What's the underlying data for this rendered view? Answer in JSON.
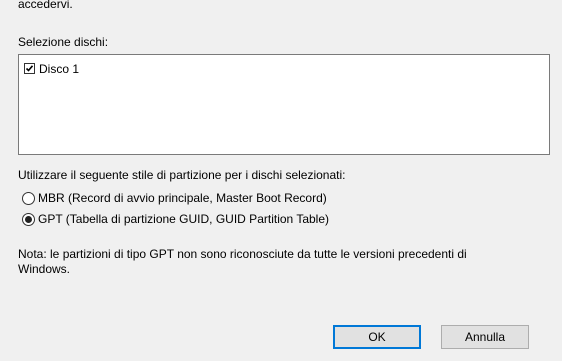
{
  "dialog": {
    "truncated_text": "accedervi.",
    "disk_selection_label": "Selezione dischi:",
    "disks": [
      {
        "label": "Disco 1",
        "checked": true
      }
    ],
    "partition_style_label": "Utilizzare il seguente stile di partizione per i dischi selezionati:",
    "options": {
      "mbr": {
        "label": "MBR (Record di avvio principale, Master Boot Record)",
        "selected": false
      },
      "gpt": {
        "label": "GPT (Tabella di partizione GUID, GUID Partition Table)",
        "selected": true
      }
    },
    "note": "Nota: le partizioni di tipo GPT non sono riconosciute da tutte le versioni precedenti di Windows.",
    "buttons": {
      "ok": "OK",
      "cancel": "Annulla"
    }
  },
  "colors": {
    "background": "#f0f0f0",
    "default_button_border": "#0078d7"
  },
  "icons": [
    "checkbox-checked-icon",
    "radio-selected-icon",
    "radio-unselected-icon"
  ]
}
